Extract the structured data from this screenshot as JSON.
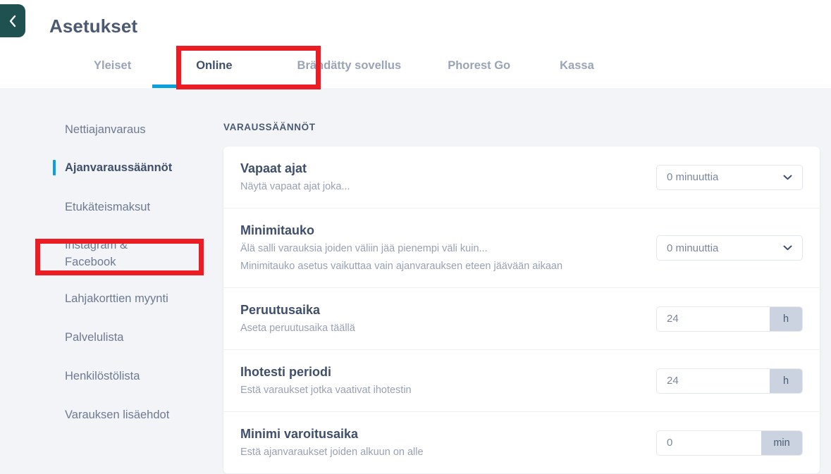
{
  "header": {
    "title": "Asetukset",
    "back_icon": "chevron-left-icon",
    "back_color": "#1e5150"
  },
  "tabs": [
    {
      "label": "Yleiset",
      "active": false
    },
    {
      "label": "Online",
      "active": true
    },
    {
      "label": "Brändätty sovellus",
      "active": false
    },
    {
      "label": "Phorest Go",
      "active": false
    },
    {
      "label": "Kassa",
      "active": false
    }
  ],
  "accent": {
    "tab_underline": "#08a0dd",
    "sidebar_indicator": "#08a0dd",
    "annotation": "#ec1c24"
  },
  "sidebar": {
    "items": [
      {
        "label": "Nettiajanvaraus",
        "active": false
      },
      {
        "label": "Ajanvaraussäännöt",
        "active": true
      },
      {
        "label": "Etukäteismaksut",
        "active": false
      },
      {
        "label": "Instagram & Facebook",
        "active": false
      },
      {
        "label": "Lahjakorttien myynti",
        "active": false
      },
      {
        "label": "Palvelulista",
        "active": false
      },
      {
        "label": "Henkilöstölista",
        "active": false
      },
      {
        "label": "Varauksen lisäehdot",
        "active": false
      }
    ]
  },
  "main": {
    "section_title": "VARAUSSÄÄNNÖT",
    "rows": [
      {
        "title": "Vapaat ajat",
        "desc1": "Näytä vapaat ajat joka...",
        "desc2": "",
        "control": "select",
        "value": "0 minuuttia",
        "unit": ""
      },
      {
        "title": "Minimitauko",
        "desc1": "Älä salli varauksia joiden väliin jää pienempi väli kuin...",
        "desc2": "Minimitauko asetus vaikuttaa vain ajanvarauksen eteen jäävään aikaan",
        "control": "select",
        "value": "0 minuuttia",
        "unit": ""
      },
      {
        "title": "Peruutusaika",
        "desc1": "Aseta peruutusaika täällä",
        "desc2": "",
        "control": "unit-input",
        "value": "24",
        "unit": "h"
      },
      {
        "title": "Ihotesti periodi",
        "desc1": "Estä varaukset jotka vaativat ihotestin",
        "desc2": "",
        "control": "unit-input",
        "value": "24",
        "unit": "h"
      },
      {
        "title": "Minimi varoitusaika",
        "desc1": "Estä ajanvaraukset joiden alkuun on alle",
        "desc2": "",
        "control": "unit-input",
        "value": "0",
        "unit": "min"
      }
    ]
  }
}
